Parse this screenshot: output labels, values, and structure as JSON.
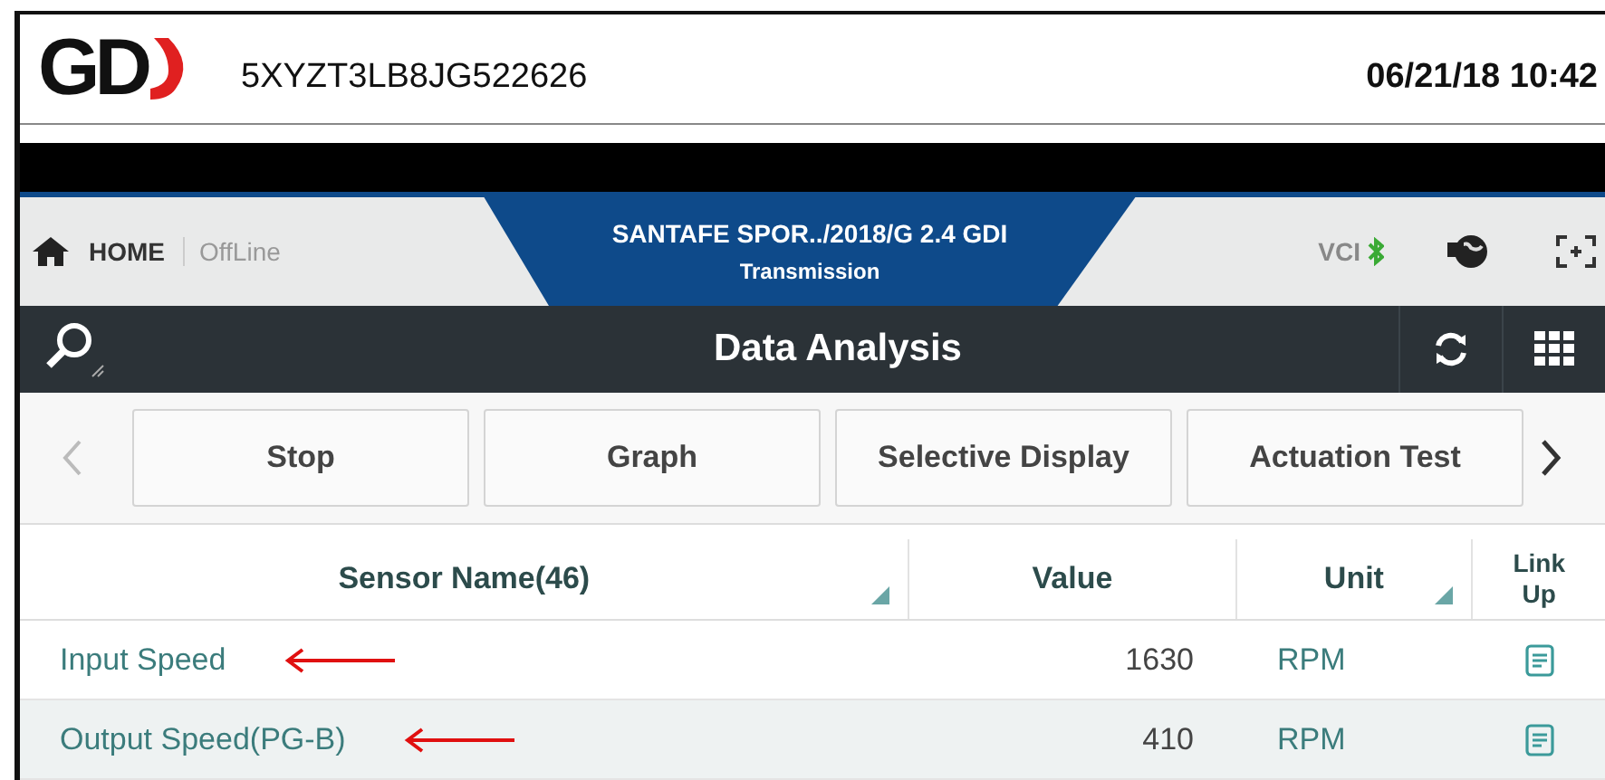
{
  "header": {
    "logo": "GD",
    "vin": "5XYZT3LB8JG522626",
    "datetime": "06/21/18 10:42"
  },
  "nav": {
    "home": "HOME",
    "mode": "OffLine",
    "vehicle": "SANTAFE SPOR../2018/G 2.4 GDI",
    "system": "Transmission",
    "vci": "VCI"
  },
  "toolbar": {
    "title": "Data Analysis"
  },
  "buttons": [
    "Stop",
    "Graph",
    "Selective Display",
    "Actuation Test"
  ],
  "table": {
    "columns": [
      "Sensor Name(46)",
      "Value",
      "Unit",
      "Link Up"
    ],
    "rows": [
      {
        "name": "Input Speed",
        "value": "1630",
        "unit": "RPM",
        "marked": true
      },
      {
        "name": "Output Speed(PG-B)",
        "value": "410",
        "unit": "RPM",
        "marked": true
      }
    ]
  }
}
